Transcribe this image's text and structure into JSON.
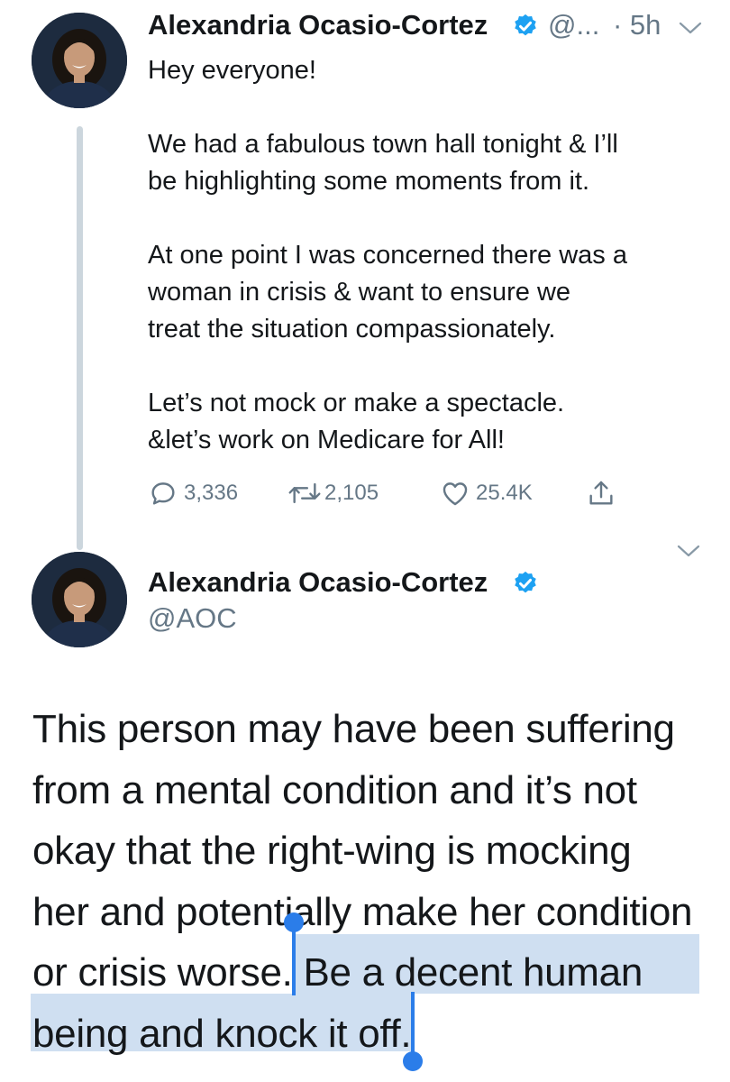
{
  "tweet1": {
    "display_name": "Alexandria Ocasio-Cortez",
    "handle": "@...",
    "time": "· 5h",
    "lines": [
      "Hey everyone!",
      "",
      "We had a fabulous town hall tonight & I’ll",
      "be highlighting some moments from it.",
      "",
      "At one point I was concerned there was a",
      "woman in crisis & want to ensure we",
      "treat the situation compassionately.",
      "",
      "Let’s not mock or make a spectacle.",
      "&let’s work on Medicare for All!"
    ],
    "actions": {
      "replies": "3,336",
      "retweets": "2,105",
      "likes": "25.4K"
    }
  },
  "tweet2": {
    "display_name": "Alexandria Ocasio-Cortez",
    "handle": "@AOC",
    "lines": [
      "This person may have been suffering",
      "from a mental condition and it’s not",
      "okay that the right-wing is mocking",
      "her and potentially make her condition",
      "or crisis worse. Be a decent human",
      "being and knock it off."
    ],
    "selected_text": "Be a decent human being and knock it off."
  },
  "icons": {
    "verified": "verified-badge-icon",
    "chevron": "chevron-down-icon",
    "reply": "reply-icon",
    "retweet": "retweet-icon",
    "like": "heart-icon",
    "share": "share-icon"
  },
  "colors": {
    "verified": "#1da1f2",
    "muted": "#657786",
    "selection": "#cfdff1",
    "handle": "#2b7de9"
  }
}
